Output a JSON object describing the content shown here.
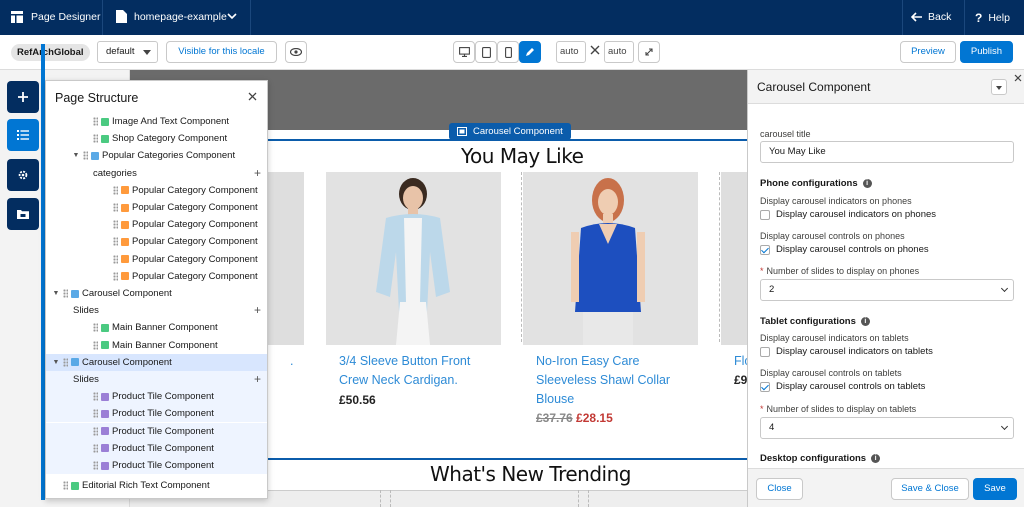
{
  "topbar": {
    "app_title": "Page Designer",
    "page_name": "homepage-example",
    "back_label": "Back",
    "help_label": "Help"
  },
  "toolbar": {
    "site": "RefArchGlobal",
    "locale_value": "default",
    "visible_locale_label": "Visible for this locale",
    "width_value": "auto",
    "height_value": "auto",
    "preview_label": "Preview",
    "publish_label": "Publish"
  },
  "canvas": {
    "component_tag": "Carousel Component",
    "heading1": "You May Like",
    "heading2": "What's New Trending",
    "products": [
      {
        "name": "3/4 Sleeve Button Front Crew Neck Cardigan.",
        "price": "£50.56"
      },
      {
        "name": "No-Iron Easy Care Sleeveless Shawl Collar Blouse",
        "old_price": "£37.76",
        "sale_price": "£28.15"
      },
      {
        "name_fragment": "Flo",
        "price_fragment": "£9"
      }
    ],
    "left_fragment": "."
  },
  "page_structure": {
    "title": "Page Structure",
    "rows": [
      {
        "label": "Image And Text Component",
        "indent": 3,
        "icon": "green",
        "expand": ""
      },
      {
        "label": "Shop Category Component",
        "indent": 3,
        "icon": "green",
        "expand": ""
      },
      {
        "label": "Popular Categories Component",
        "indent": 2,
        "icon": "blue",
        "expand": "▼"
      },
      {
        "label": "categories",
        "indent": 3,
        "icon": "",
        "expand": "",
        "plus": true
      },
      {
        "label": "Popular Category Component",
        "indent": 5,
        "icon": "orange",
        "expand": ""
      },
      {
        "label": "Popular Category Component",
        "indent": 5,
        "icon": "orange",
        "expand": ""
      },
      {
        "label": "Popular Category Component",
        "indent": 5,
        "icon": "orange",
        "expand": ""
      },
      {
        "label": "Popular Category Component",
        "indent": 5,
        "icon": "orange",
        "expand": ""
      },
      {
        "label": "Popular Category Component",
        "indent": 5,
        "icon": "orange",
        "expand": ""
      },
      {
        "label": "Popular Category Component",
        "indent": 5,
        "icon": "orange",
        "expand": ""
      },
      {
        "label": "Carousel Component",
        "indent": 0,
        "icon": "blue",
        "expand": "▼"
      },
      {
        "label": "Slides",
        "indent": 1,
        "icon": "",
        "expand": "",
        "plus": true
      },
      {
        "label": "Main Banner Component",
        "indent": 3,
        "icon": "green",
        "expand": ""
      },
      {
        "label": "Main Banner Component",
        "indent": 3,
        "icon": "green",
        "expand": ""
      },
      {
        "label": "Carousel Component",
        "indent": 0,
        "icon": "blue",
        "expand": "▼",
        "selected": true
      },
      {
        "label": "Slides",
        "indent": 1,
        "icon": "",
        "expand": "",
        "plus": true,
        "group": true
      },
      {
        "label": "Product Tile Component",
        "indent": 3,
        "icon": "purple",
        "expand": "",
        "group": true
      },
      {
        "label": "Product Tile Component",
        "indent": 3,
        "icon": "purple",
        "expand": "",
        "group": true
      },
      {
        "label": "Product Tile Component",
        "indent": 3,
        "icon": "purple",
        "expand": "",
        "group": true
      },
      {
        "label": "Product Tile Component",
        "indent": 3,
        "icon": "purple",
        "expand": "",
        "group": true
      },
      {
        "label": "Product Tile Component",
        "indent": 3,
        "icon": "purple",
        "expand": "",
        "group": true
      },
      {
        "label": "Editorial Rich Text Component",
        "indent": 0,
        "icon": "green",
        "expand": "",
        "gap": true
      }
    ]
  },
  "right_panel": {
    "title": "Carousel Component",
    "carousel_title_label": "carousel title",
    "carousel_title_value": "You May Like",
    "phone": {
      "heading": "Phone configurations",
      "indicators_label": "Display carousel indicators on phones",
      "indicators_check": "Display carousel indicators on phones",
      "controls_label": "Display carousel controls on phones",
      "controls_check": "Display carousel controls on phones",
      "slides_label": "Number of slides to display on phones",
      "slides_value": "2"
    },
    "tablet": {
      "heading": "Tablet configurations",
      "indicators_label": "Display carousel indicators on tablets",
      "indicators_check": "Display carousel indicators on tablets",
      "controls_label": "Display carousel controls on tablets",
      "controls_check": "Display carousel controls on tablets",
      "slides_label": "Number of slides to display on tablets",
      "slides_value": "4"
    },
    "desktop_heading": "Desktop configurations",
    "close_label": "Close",
    "save_close_label": "Save & Close",
    "save_label": "Save"
  }
}
